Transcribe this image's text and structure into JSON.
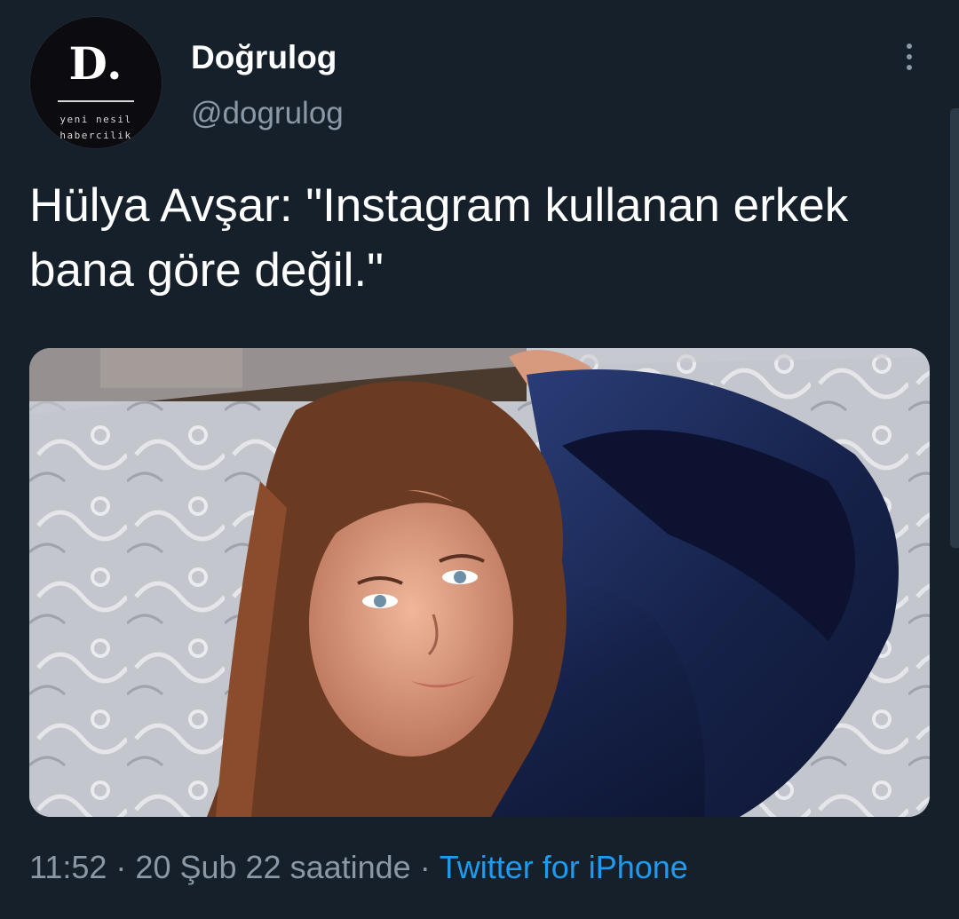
{
  "author": {
    "display_name": "Doğrulog",
    "handle": "@dogrulog",
    "avatar": {
      "logo_letter": "D.",
      "tagline_line1": "yeni nesil",
      "tagline_line2": "habercilik"
    }
  },
  "tweet": {
    "text": "Hülya Avşar: \"Instagram kullanan erkek bana göre değil.\"",
    "time": "11:52",
    "date": "20 Şub 22 saatinde",
    "separator": "·",
    "source": "Twitter for iPhone"
  },
  "icons": {
    "more": "more-vertical-icon"
  },
  "colors": {
    "background": "#15202b",
    "text_primary": "#ffffff",
    "text_secondary": "#8b98a5",
    "link": "#1d9bf0"
  }
}
